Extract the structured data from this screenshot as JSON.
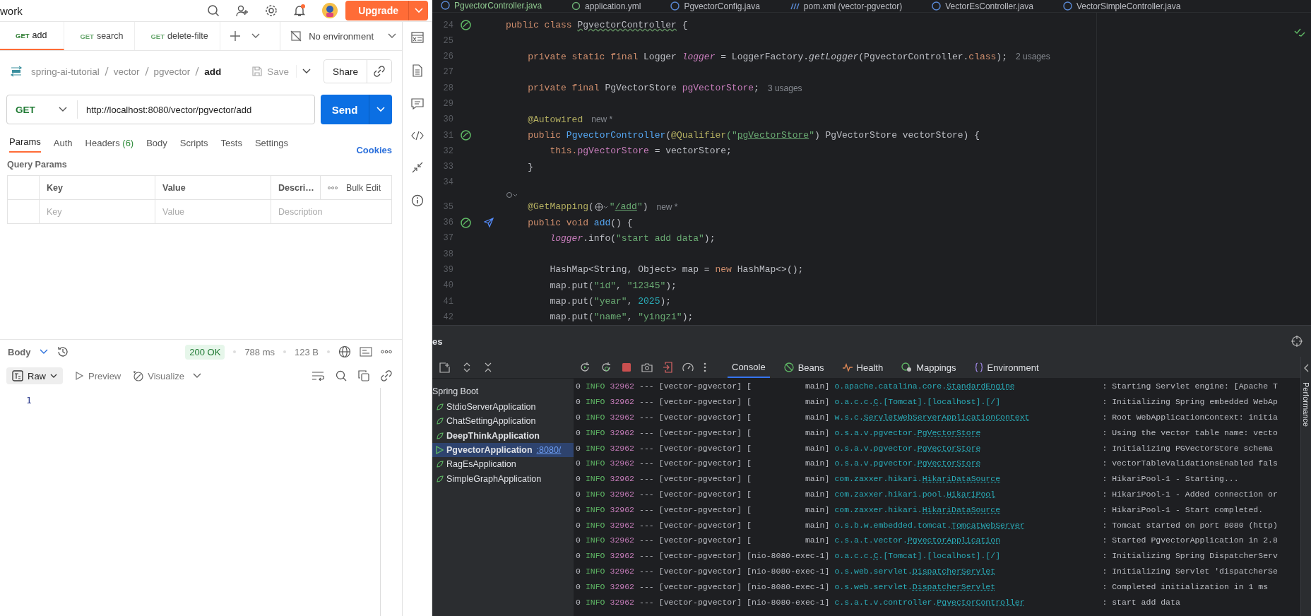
{
  "postman": {
    "top_bar": {
      "title": "work",
      "upgrade_label": "Upgrade"
    },
    "tabs": [
      {
        "method": "GET",
        "label": "add",
        "selected": true
      },
      {
        "method": "GET",
        "label": "search",
        "selected": false
      },
      {
        "method": "GET",
        "label": "delete-filte",
        "selected": false
      }
    ],
    "environment": "No environment",
    "breadcrumb": [
      "spring-ai-tutorial",
      "vector",
      "pgvector",
      "add"
    ],
    "save_label": "Save",
    "share_label": "Share",
    "request": {
      "method": "GET",
      "url": "http://localhost:8080/vector/pgvector/add",
      "send_label": "Send"
    },
    "request_tabs": [
      {
        "label": "Params",
        "selected": true
      },
      {
        "label": "Auth",
        "selected": false
      },
      {
        "label": "Headers",
        "count": "(6)",
        "selected": false
      },
      {
        "label": "Body",
        "selected": false
      },
      {
        "label": "Scripts",
        "selected": false
      },
      {
        "label": "Tests",
        "selected": false
      },
      {
        "label": "Settings",
        "selected": false
      }
    ],
    "cookies": "Cookies",
    "query_params": {
      "title": "Query Params",
      "columns": [
        "Key",
        "Value",
        "Descri…"
      ],
      "bulk_edit": "Bulk Edit",
      "placeholders": [
        "Key",
        "Value",
        "Description"
      ]
    },
    "response": {
      "label": "Body",
      "status": "200 OK",
      "time": "788 ms",
      "size": "123 B",
      "view_tabs": [
        {
          "label": "Raw",
          "selected": true
        },
        {
          "label": "Preview",
          "selected": false
        },
        {
          "label": "Visualize",
          "selected": false
        }
      ],
      "line_numbers": [
        "1"
      ]
    }
  },
  "editor": {
    "file_tabs": [
      {
        "label": "PgvectorController.java",
        "selected": true
      },
      {
        "label": "application.yml",
        "selected": false
      },
      {
        "label": "PgvectorConfig.java",
        "selected": false
      },
      {
        "label": "pom.xml (vector-pgvector)",
        "selected": false
      },
      {
        "label": "VectorEsController.java",
        "selected": false
      },
      {
        "label": "VectorSimpleController.java",
        "selected": false
      }
    ],
    "lines": [
      {
        "number": "24",
        "bean_marker": true,
        "tokens": [
          {
            "text": "public class ",
            "kind": "keyword"
          },
          {
            "text": "PgvectorController",
            "kind": "typo"
          },
          {
            "text": " {",
            "kind": "plain"
          }
        ]
      },
      {
        "number": "25"
      },
      {
        "number": "26",
        "tokens": [
          {
            "text": "    private static final ",
            "kind": "keyword"
          },
          {
            "text": "Logger ",
            "kind": "plain"
          },
          {
            "text": "logger",
            "kind": "static"
          },
          {
            "text": " = LoggerFactory.",
            "kind": "plain"
          },
          {
            "text": "getLogger",
            "kind": "call"
          },
          {
            "text": "(PgvectorController.",
            "kind": "plain"
          },
          {
            "text": "class",
            "kind": "keyword"
          },
          {
            "text": ");",
            "kind": "plain"
          }
        ],
        "hint": "2 usages"
      },
      {
        "number": "27"
      },
      {
        "number": "28",
        "tokens": [
          {
            "text": "    private final ",
            "kind": "keyword"
          },
          {
            "text": "PgVectorStore ",
            "kind": "plain"
          },
          {
            "text": "pgVectorStore",
            "kind": "field"
          },
          {
            "text": ";",
            "kind": "plain"
          }
        ],
        "hint": "3 usages"
      },
      {
        "number": "29"
      },
      {
        "number": "30",
        "tokens": [
          {
            "text": "    @Autowired",
            "kind": "annotation"
          }
        ],
        "hint": "new *"
      },
      {
        "number": "31",
        "bean_marker": true,
        "tokens": [
          {
            "text": "    public ",
            "kind": "keyword"
          },
          {
            "text": "PgvectorController",
            "kind": "function"
          },
          {
            "text": "(",
            "kind": "plain"
          },
          {
            "text": "@Qualifier",
            "kind": "annotation"
          },
          {
            "text": "(\"",
            "kind": "string"
          },
          {
            "text": "pgVectorStore",
            "kind": "link"
          },
          {
            "text": "\"",
            "kind": "string"
          },
          {
            "text": ") PgVectorStore vectorStore) {",
            "kind": "plain"
          }
        ]
      },
      {
        "number": "32",
        "tokens": [
          {
            "text": "        this.",
            "kind": "keyword"
          },
          {
            "text": "pgVectorStore",
            "kind": "field"
          },
          {
            "text": " = vectorStore;",
            "kind": "plain"
          }
        ]
      },
      {
        "number": "33",
        "tokens": [
          {
            "text": "    }",
            "kind": "plain"
          }
        ]
      },
      {
        "number": "34"
      },
      {
        "number": "35",
        "inlay": true,
        "tokens": [
          {
            "text": "    @GetMapping",
            "kind": "annotation"
          },
          {
            "text": "(",
            "kind": "plain"
          },
          {
            "kind": "globe"
          },
          {
            "text": "\"",
            "kind": "string"
          },
          {
            "text": "/add",
            "kind": "link"
          },
          {
            "text": "\"",
            "kind": "string"
          },
          {
            "text": ")",
            "kind": "plain"
          }
        ],
        "hint": "new *"
      },
      {
        "number": "36",
        "bean_marker": true,
        "request_marker": true,
        "tokens": [
          {
            "text": "    public void ",
            "kind": "keyword"
          },
          {
            "text": "add",
            "kind": "function"
          },
          {
            "text": "() {",
            "kind": "plain"
          }
        ]
      },
      {
        "number": "37",
        "tokens": [
          {
            "text": "        logger",
            "kind": "static"
          },
          {
            "text": ".info(",
            "kind": "plain"
          },
          {
            "text": "\"start add data\"",
            "kind": "string"
          },
          {
            "text": ");",
            "kind": "plain"
          }
        ]
      },
      {
        "number": "38"
      },
      {
        "number": "39",
        "tokens": [
          {
            "text": "        HashMap<String, Object> map = ",
            "kind": "plain"
          },
          {
            "text": "new ",
            "kind": "keyword"
          },
          {
            "text": "HashMap<>();",
            "kind": "plain"
          }
        ]
      },
      {
        "number": "40",
        "tokens": [
          {
            "text": "        map.put(",
            "kind": "plain"
          },
          {
            "text": "\"id\"",
            "kind": "string"
          },
          {
            "text": ", ",
            "kind": "plain"
          },
          {
            "text": "\"12345\"",
            "kind": "string"
          },
          {
            "text": ");",
            "kind": "plain"
          }
        ]
      },
      {
        "number": "41",
        "tokens": [
          {
            "text": "        map.put(",
            "kind": "plain"
          },
          {
            "text": "\"year\"",
            "kind": "string"
          },
          {
            "text": ", ",
            "kind": "plain"
          },
          {
            "text": "2025",
            "kind": "number"
          },
          {
            "text": ");",
            "kind": "plain"
          }
        ]
      },
      {
        "number": "42",
        "tokens": [
          {
            "text": "        map.put(",
            "kind": "plain"
          },
          {
            "text": "\"name\"",
            "kind": "string"
          },
          {
            "text": ", ",
            "kind": "plain"
          },
          {
            "text": "\"yingzi\"",
            "kind": "string"
          },
          {
            "text": ");",
            "kind": "plain"
          }
        ]
      }
    ]
  },
  "services": {
    "title": "es",
    "tree": [
      {
        "label": "Spring Boot",
        "children": [
          {
            "label": "StdioServerApplication",
            "running": false,
            "emphasized": false,
            "selected": false
          },
          {
            "label": "ChatSettingApplication",
            "running": false,
            "emphasized": false,
            "selected": false
          },
          {
            "label": "DeepThinkApplication",
            "running": false,
            "emphasized": true,
            "selected": false
          },
          {
            "label": "PgvectorApplication",
            "port": ":8080/",
            "running": true,
            "emphasized": true,
            "selected": true
          },
          {
            "label": "RagEsApplication",
            "running": false,
            "emphasized": false,
            "selected": false
          },
          {
            "label": "SimpleGraphApplication",
            "running": false,
            "emphasized": false,
            "selected": false
          }
        ]
      }
    ],
    "console_tabs": [
      {
        "label": "Console",
        "kind": "console",
        "selected": true
      },
      {
        "label": "Beans",
        "kind": "beans",
        "selected": false
      },
      {
        "label": "Health",
        "kind": "health",
        "selected": false
      },
      {
        "label": "Mappings",
        "kind": "mappings",
        "selected": false
      },
      {
        "label": "Environment",
        "kind": "environment",
        "selected": false
      }
    ],
    "log": [
      {
        "time": "0",
        "level": "INFO",
        "pid": "32962",
        "sep": "---",
        "app": "[vector-pgvector]",
        "thread": "[           main]",
        "logger": "o.apache.catalina.core.",
        "logger_class": "StandardEngine",
        "message": ": Starting Servlet engine: [Apache T"
      },
      {
        "time": "0",
        "level": "INFO",
        "pid": "32962",
        "sep": "---",
        "app": "[vector-pgvector]",
        "thread": "[           main]",
        "logger": "o.a.c.c.",
        "logger_class": "C",
        "logger_suffix": ".[Tomcat].[localhost].[/]",
        "message": ": Initializing Spring embedded WebAp"
      },
      {
        "time": "0",
        "level": "INFO",
        "pid": "32962",
        "sep": "---",
        "app": "[vector-pgvector]",
        "thread": "[           main]",
        "logger": "w.s.c.",
        "logger_class": "ServletWebServerApplicationContext",
        "message": ": Root WebApplicationContext: initia"
      },
      {
        "time": "0",
        "level": "INFO",
        "pid": "32962",
        "sep": "---",
        "app": "[vector-pgvector]",
        "thread": "[           main]",
        "logger": "o.s.a.v.pgvector.",
        "logger_class": "PgVectorStore",
        "message": ": Using the vector table name: vecto"
      },
      {
        "time": "0",
        "level": "INFO",
        "pid": "32962",
        "sep": "---",
        "app": "[vector-pgvector]",
        "thread": "[           main]",
        "logger": "o.s.a.v.pgvector.",
        "logger_class": "PgVectorStore",
        "message": ": Initializing PGVectorStore schema"
      },
      {
        "time": "0",
        "level": "INFO",
        "pid": "32962",
        "sep": "---",
        "app": "[vector-pgvector]",
        "thread": "[           main]",
        "logger": "o.s.a.v.pgvector.",
        "logger_class": "PgVectorStore",
        "message": ": vectorTableValidationsEnabled fals"
      },
      {
        "time": "0",
        "level": "INFO",
        "pid": "32962",
        "sep": "---",
        "app": "[vector-pgvector]",
        "thread": "[           main]",
        "logger": "com.zaxxer.hikari.",
        "logger_class": "HikariDataSource",
        "message": ": HikariPool-1 - Starting..."
      },
      {
        "time": "0",
        "level": "INFO",
        "pid": "32962",
        "sep": "---",
        "app": "[vector-pgvector]",
        "thread": "[           main]",
        "logger": "com.zaxxer.hikari.pool.",
        "logger_class": "HikariPool",
        "message": ": HikariPool-1 - Added connection or"
      },
      {
        "time": "0",
        "level": "INFO",
        "pid": "32962",
        "sep": "---",
        "app": "[vector-pgvector]",
        "thread": "[           main]",
        "logger": "com.zaxxer.hikari.",
        "logger_class": "HikariDataSource",
        "message": ": HikariPool-1 - Start completed."
      },
      {
        "time": "0",
        "level": "INFO",
        "pid": "32962",
        "sep": "---",
        "app": "[vector-pgvector]",
        "thread": "[           main]",
        "logger": "o.s.b.w.embedded.tomcat.",
        "logger_class": "TomcatWebServer",
        "message": ": Tomcat started on port 8080 (http)"
      },
      {
        "time": "0",
        "level": "INFO",
        "pid": "32962",
        "sep": "---",
        "app": "[vector-pgvector]",
        "thread": "[           main]",
        "logger": "c.s.a.t.vector.",
        "logger_class": "PgvectorApplication",
        "message": ": Started PgvectorApplication in 2.8"
      },
      {
        "time": "0",
        "level": "INFO",
        "pid": "32962",
        "sep": "---",
        "app": "[vector-pgvector]",
        "thread": "[nio-8080-exec-1]",
        "logger": "o.a.c.c.",
        "logger_class": "C",
        "logger_suffix": ".[Tomcat].[localhost].[/]",
        "message": ": Initializing Spring DispatcherServ"
      },
      {
        "time": "0",
        "level": "INFO",
        "pid": "32962",
        "sep": "---",
        "app": "[vector-pgvector]",
        "thread": "[nio-8080-exec-1]",
        "logger": "o.s.web.servlet.",
        "logger_class": "DispatcherServlet",
        "message": ": Initializing Servlet 'dispatcherSe"
      },
      {
        "time": "0",
        "level": "INFO",
        "pid": "32962",
        "sep": "---",
        "app": "[vector-pgvector]",
        "thread": "[nio-8080-exec-1]",
        "logger": "o.s.web.servlet.",
        "logger_class": "DispatcherServlet",
        "message": ": Completed initialization in 1 ms"
      },
      {
        "time": "0",
        "level": "INFO",
        "pid": "32962",
        "sep": "---",
        "app": "[vector-pgvector]",
        "thread": "[nio-8080-exec-1]",
        "logger": "c.s.a.t.v.controller.",
        "logger_class": "PgvectorController",
        "message": ": start add data"
      }
    ],
    "side_tab": "Performance"
  }
}
